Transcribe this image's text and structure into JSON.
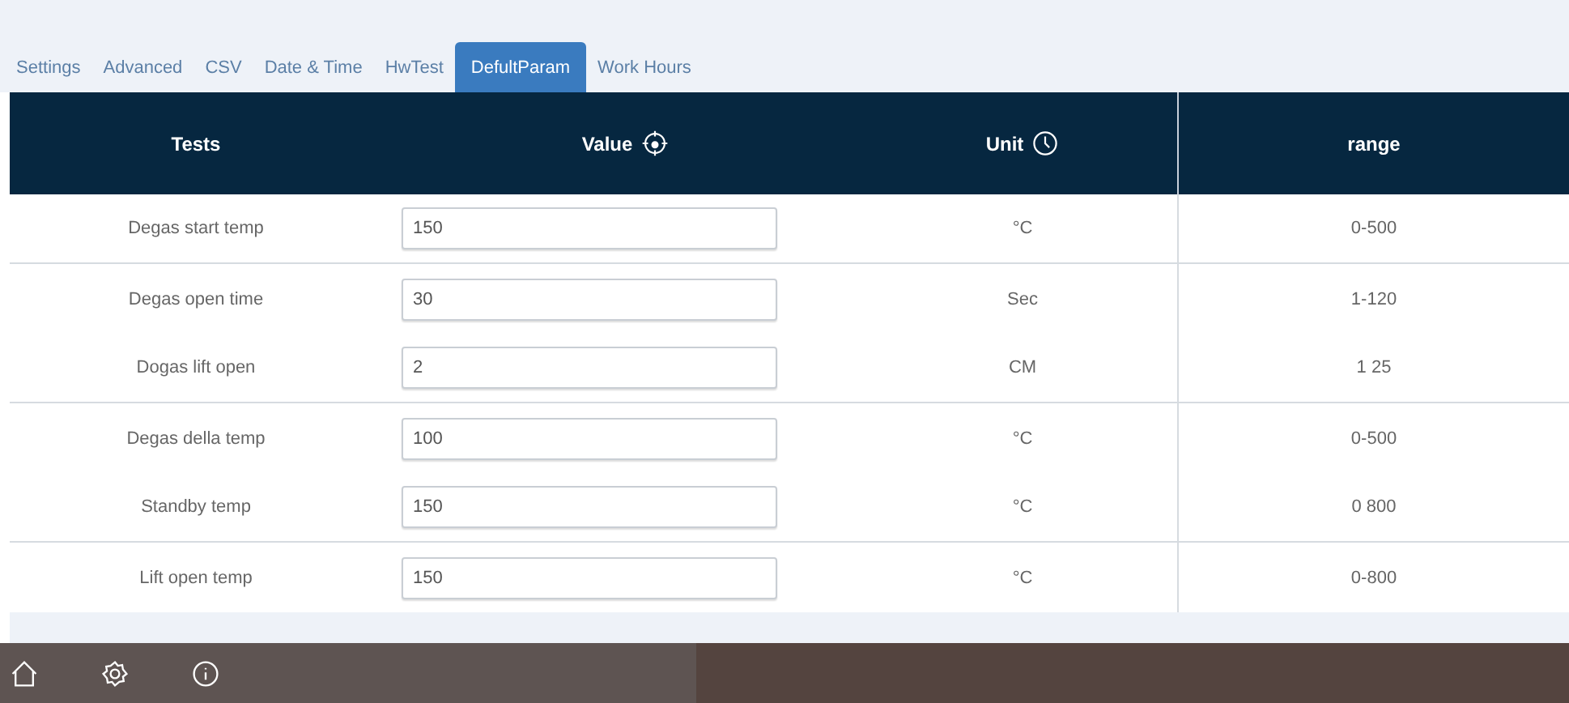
{
  "tabs": [
    {
      "label": "Settings",
      "selected": false
    },
    {
      "label": "Advanced",
      "selected": false
    },
    {
      "label": "CSV",
      "selected": false
    },
    {
      "label": "Date & Time",
      "selected": false
    },
    {
      "label": "HwTest",
      "selected": false
    },
    {
      "label": "DefultParam",
      "selected": true
    },
    {
      "label": "Work Hours",
      "selected": false
    }
  ],
  "table": {
    "columns": [
      {
        "label": "Tests"
      },
      {
        "label": "Value"
      },
      {
        "label": "Unit"
      },
      {
        "label": "range"
      }
    ],
    "rows": [
      {
        "test": "Degas start temp",
        "value": "150",
        "unit": "°C",
        "range": "0-500",
        "divider": true
      },
      {
        "test": "Degas open time",
        "value": "30",
        "unit": "Sec",
        "range": "1-120",
        "divider": false
      },
      {
        "test": "Dogas lift open",
        "value": "2",
        "unit": "CM",
        "range": "1 25",
        "divider": true
      },
      {
        "test": "Degas della temp",
        "value": "100",
        "unit": "°C",
        "range": "0-500",
        "divider": false
      },
      {
        "test": "Standby temp",
        "value": "150",
        "unit": "°C",
        "range": "0 800",
        "divider": true
      },
      {
        "test": "Lift open temp",
        "value": "150",
        "unit": "°C",
        "range": "0-800",
        "divider": false
      }
    ]
  }
}
